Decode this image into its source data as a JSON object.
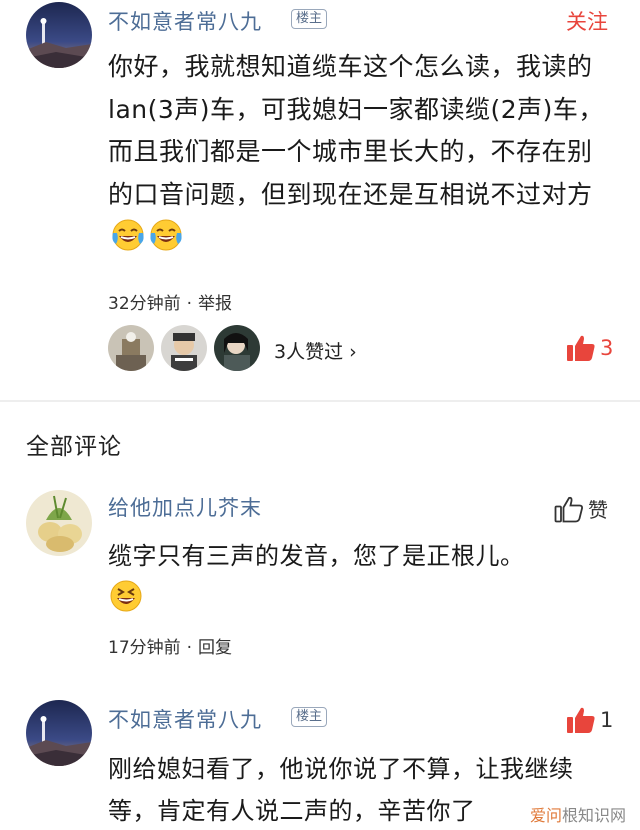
{
  "post": {
    "username": "不如意者常八九",
    "badge": "楼主",
    "follow_label": "关注",
    "text": "你好，我就想知道缆车这个怎么读，我读的lan(3声)车，可我媳妇一家都读缆(2声)车，而且我们都是一个城市里长大的，不存在别的口音问题，但到现在还是互相说不过对方",
    "emojis": [
      "laugh-cry",
      "laugh-cry"
    ],
    "time": "32分钟前",
    "report_label": "举报",
    "likers_text": "3人赞过 ›",
    "like_count": "3"
  },
  "section_title": "全部评论",
  "comments": [
    {
      "username": "给他加点儿芥末",
      "like_label": "赞",
      "text": "缆字只有三声的发音，您了是正根儿。",
      "emoji": "grin",
      "time": "17分钟前",
      "reply_label": "回复"
    },
    {
      "username": "不如意者常八九",
      "badge": "楼主",
      "like_count": "1",
      "text": "刚给媳妇看了，他说你说了不算，让我继续等，肯定有人说二声的，辛苦你了"
    }
  ],
  "watermark": {
    "part_a": "爱问",
    "part_b": "根知识网"
  },
  "colors": {
    "username": "#4d6d96",
    "accent_red": "#e8453c",
    "like_active": "#e8453c"
  }
}
